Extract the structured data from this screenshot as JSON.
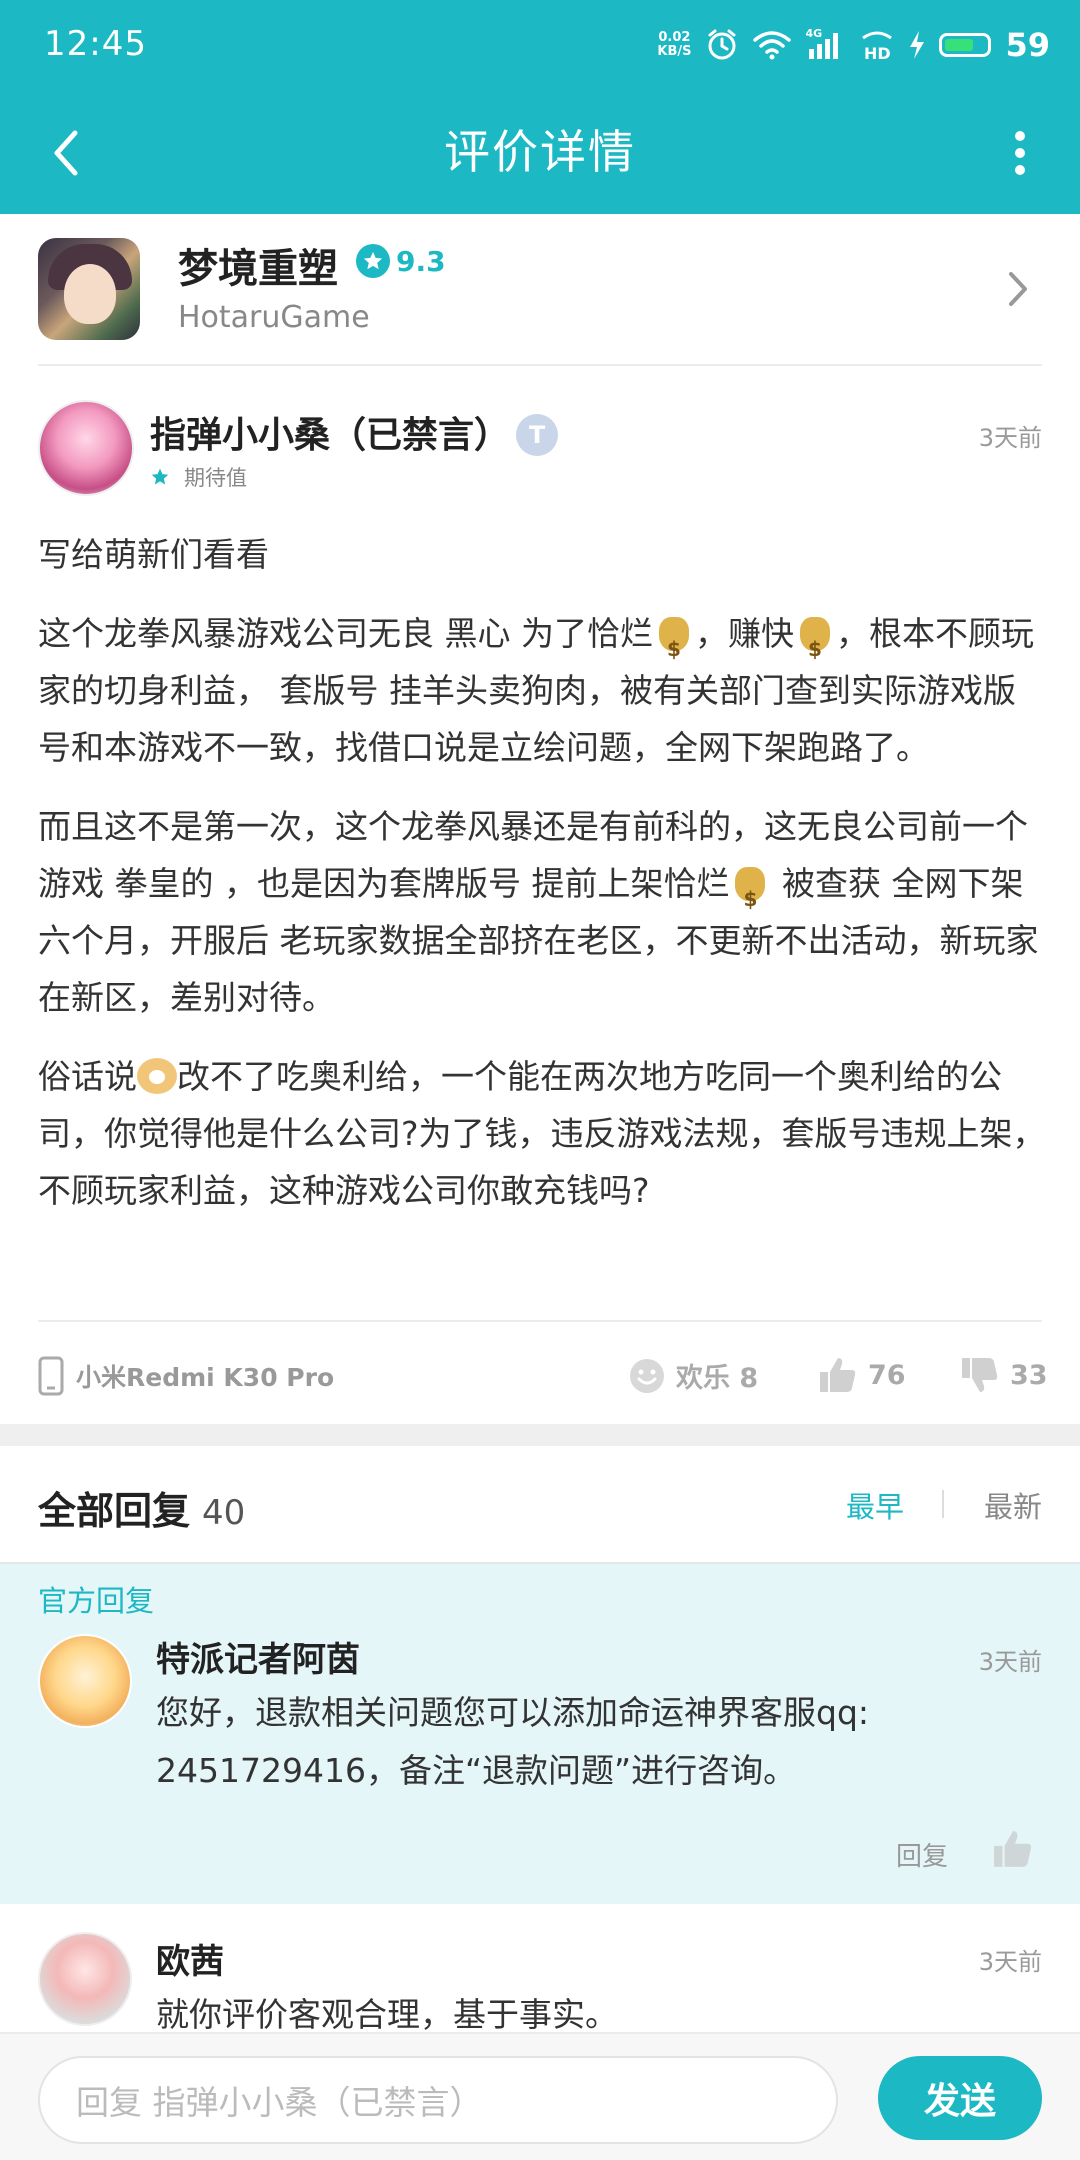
{
  "status_bar": {
    "time": "12:45",
    "net_speed_value": "0.02",
    "net_speed_unit": "KB/S",
    "network_label": "4G",
    "battery": "59",
    "icons": [
      "alarm-icon",
      "wifi-icon",
      "signal-icon",
      "hd-call-icon",
      "charging-icon",
      "battery-icon"
    ]
  },
  "nav": {
    "title": "评价详情",
    "back_icon": "back-arrow-icon",
    "more_icon": "more-vertical-icon"
  },
  "game": {
    "name": "梦境重塑",
    "rating": "9.3",
    "developer": "HotaruGame"
  },
  "review": {
    "author": "指弹小小桑（已禁言）",
    "level_badge": "T",
    "time": "3天前",
    "expect_label": "期待值",
    "paragraphs": {
      "p1": "写给萌新们看看",
      "p2_a": "这个龙拳风暴游戏公司无良 黑心 为了恰烂",
      "p2_b": "，赚快",
      "p2_c": "，根本不顾玩家的切身利益， 套版号 挂羊头卖狗肉，被有关部门查到实际游戏版号和本游戏不一致，找借口说是立绘问题，全网下架跑路了。",
      "p3_a": "而且这不是第一次，这个龙拳风暴还是有前科的，这无良公司前一个游戏 拳皇的 ，也是因为套牌版号 提前上架恰烂",
      "p3_b": " 被查获 全网下架六个月，开服后 老玩家数据全部挤在老区，不更新不出活动，新玩家在新区，差别对待。",
      "p4_a": "俗话说",
      "p4_b": "改不了吃奥利给，一个能在两次地方吃同一个奥利给的公司，你觉得他是什么公司?为了钱，违反游戏法规，套版号违规上架，不顾玩家利益，这种游戏公司你敢充钱吗?"
    },
    "device": "小米Redmi K30 Pro",
    "fun_label": "欢乐 8",
    "likes": "76",
    "dislikes": "33"
  },
  "replies": {
    "title": "全部回复",
    "count": "40",
    "sort_earliest": "最早",
    "sort_latest": "最新",
    "official": {
      "label": "官方回复",
      "name": "特派记者阿茵",
      "time": "3天前",
      "text_line1": "您好，退款相关问题您可以添加命运神界客服qq:",
      "text_line2": "2451729416，备注“退款问题”进行咨询。",
      "reply_label": "回复"
    },
    "second": {
      "name": "欧茜",
      "time": "3天前",
      "text": "就你评价客观合理，基于事实。"
    }
  },
  "bottom": {
    "input_placeholder": "回复 指弹小小桑（已禁言）",
    "send_label": "发送"
  },
  "colors": {
    "accent": "#1cb8c4",
    "official_bg": "#e4f6f8"
  }
}
